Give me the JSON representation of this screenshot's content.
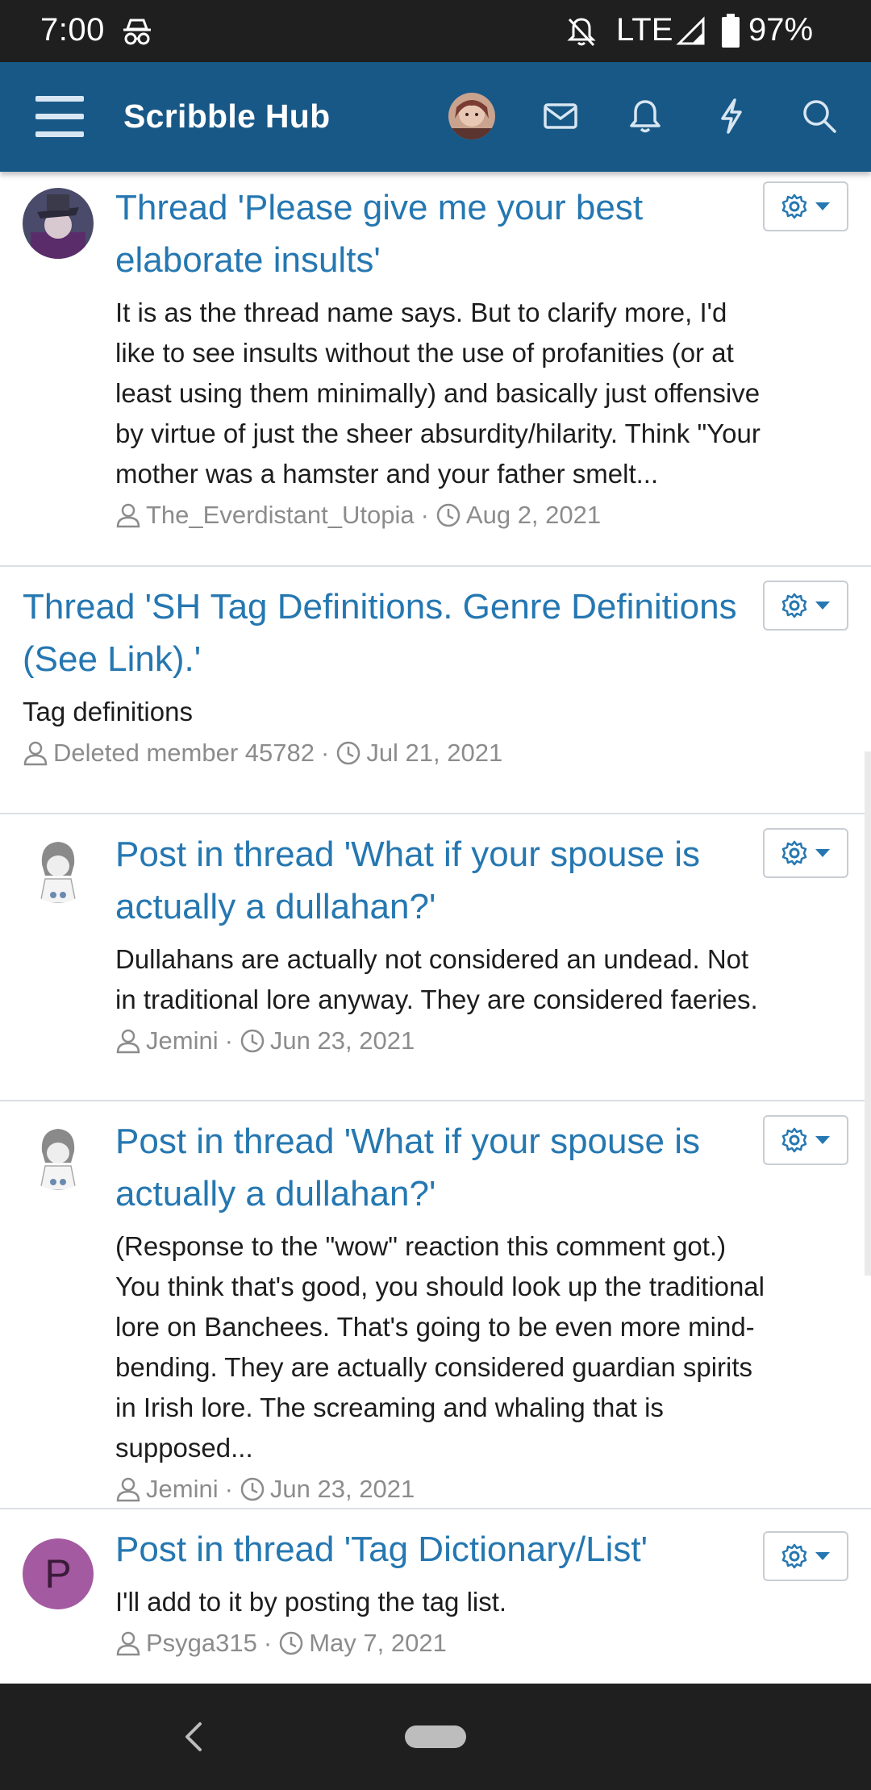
{
  "status_bar": {
    "time": "7:00",
    "network": "LTE",
    "battery": "97%"
  },
  "header": {
    "brand": "Scribble Hub",
    "icons": [
      "user-avatar",
      "mail-icon",
      "bell-icon",
      "bolt-icon",
      "search-icon"
    ],
    "background": "#185886"
  },
  "colors": {
    "link": "#2577b1",
    "meta": "#8c8c8c",
    "divider": "#dcdfe3"
  },
  "items": [
    {
      "title": "Thread 'Please give me your best elaborate insults'",
      "snippet": "It is as the thread name says. But to clarify more, I'd like to see insults without the use of profanities (or at least using them minimally) and basically just offensive by virtue of just the sheer absurdity/hilarity. Think \"Your mother was a hamster and your father smelt...",
      "author": "The_Everdistant_Utopia",
      "date": "Aug 2, 2021"
    },
    {
      "title": "Thread 'SH Tag Definitions. Genre Definitions (See Link).'",
      "snippet": "Tag definitions",
      "author": "Deleted member 45782",
      "date": "Jul 21, 2021"
    },
    {
      "title": "Post in thread 'What if your spouse is actually a dullahan?'",
      "snippet": "Dullahans are actually not considered an undead. Not in traditional lore anyway. They are considered faeries.",
      "author": "Jemini",
      "date": "Jun 23, 2021"
    },
    {
      "title": "Post in thread 'What if your spouse is actually a dullahan?'",
      "snippet": "(Response to the \"wow\" reaction this comment got.) You think that's good, you should look up the traditional lore on Banchees. That's going to be even more mind-bending. They are actually considered guardian spirits in Irish lore. The screaming and whaling that is supposed...",
      "author": "Jemini",
      "date": "Jun 23, 2021"
    },
    {
      "title": "Post in thread 'Tag Dictionary/List'",
      "snippet": "I'll add to it by posting the tag list.",
      "author": "Psyga315",
      "date": "May 7, 2021",
      "avatar_letter": "P"
    }
  ]
}
